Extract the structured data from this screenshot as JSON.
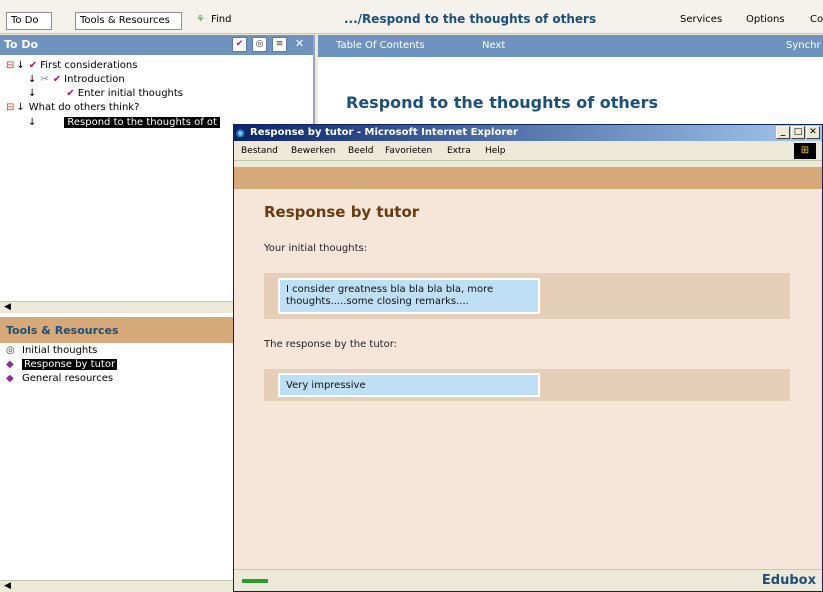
{
  "topbar": {
    "tab_todo": "To Do",
    "tab_tools": "Tools & Resources",
    "find_label": "Find",
    "page_heading": ".../Respond to the thoughts of others",
    "menu_services": "Services",
    "menu_options": "Options",
    "menu_co": "Co"
  },
  "todo": {
    "header": "To Do",
    "items": [
      {
        "label": "First considerations"
      },
      {
        "label": "Introduction"
      },
      {
        "label": "Enter initial thoughts"
      },
      {
        "label": "What do others think?"
      },
      {
        "label": "Respond to the thoughts of ot"
      }
    ]
  },
  "tools": {
    "header": "Tools & Resources",
    "items": [
      {
        "label": "Initial thoughts"
      },
      {
        "label": "Response by tutor"
      },
      {
        "label": "General resources"
      }
    ]
  },
  "main": {
    "nav_toc": "Table Of Contents",
    "nav_next": "Next",
    "nav_sync": "Synchr",
    "title": "Respond to the thoughts of others"
  },
  "popup": {
    "title": "Response by tutor - Microsoft Internet Explorer",
    "menu": [
      "Bestand",
      "Bewerken",
      "Beeld",
      "Favorieten",
      "Extra",
      "Help"
    ],
    "heading": "Response by tutor",
    "label_initial": "Your initial thoughts:",
    "initial_text": "I consider greatness bla bla bla bla, more thoughts.....some closing remarks....",
    "label_response": "The response by the tutor:",
    "response_text": "Very impressive",
    "status_brand": "Edubox"
  },
  "colors": {
    "nav_blue": "#6f93bf",
    "accent_tan": "#d7a878",
    "heading_blue": "#1c4f7a",
    "popup_bg": "#f6e6d9"
  }
}
